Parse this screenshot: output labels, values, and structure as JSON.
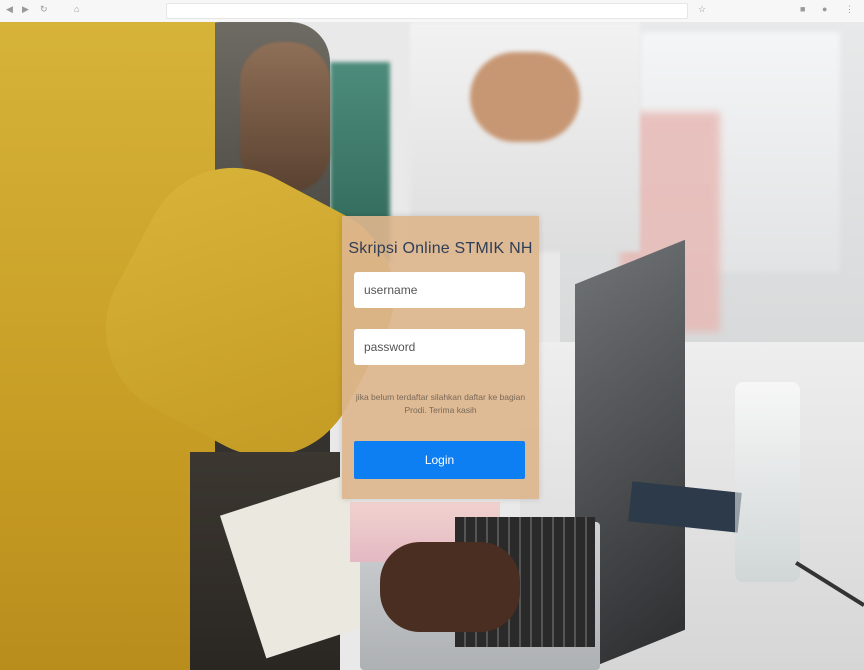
{
  "login": {
    "title": "Skripsi Online STMIK NH",
    "username_placeholder": "username",
    "password_placeholder": "password",
    "info": "jika belum terdaftar silahkan daftar ke bagian Prodi. Terima kasih",
    "button_label": "Login",
    "button_color": "#0d7ff3",
    "card_color": "#dcb58d"
  }
}
